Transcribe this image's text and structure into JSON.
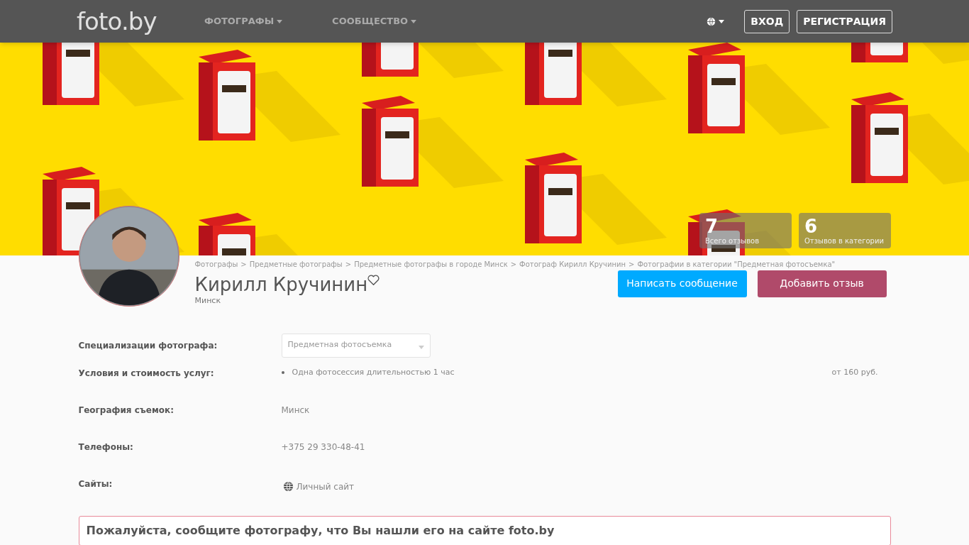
{
  "header": {
    "logo": "foto.by",
    "nav": [
      {
        "label": "ФОТОГРАФЫ"
      },
      {
        "label": "СООБЩЕСТВО"
      }
    ],
    "buttons": [
      "ВХОД",
      "РЕГИСТРАЦИЯ"
    ]
  },
  "stats": [
    {
      "value": "7",
      "label": "Всего отзывов"
    },
    {
      "value": "6",
      "label": "Отзывов в категории"
    }
  ],
  "breadcrumb": {
    "separator": ">",
    "items": [
      "Фотографы",
      "Предметные фотографы",
      "Предметные фотографы в городе Минск",
      "Фотограф Кирилл Кручинин",
      "Фотографии в категории \"Предметная фотосъемка\""
    ]
  },
  "profile": {
    "name": "Кирилл Кручинин",
    "city": "Минск",
    "favorite": false
  },
  "actions": [
    {
      "label": "Написать сообщение",
      "kind": "primary"
    },
    {
      "label": "Добавить отзыв",
      "kind": "secondary"
    }
  ],
  "details": [
    {
      "kind": "select",
      "label": "Специализации фотографа:",
      "value": "Предметная фотосъемка"
    },
    {
      "kind": "price",
      "label": "Условия и стоимость услуг:",
      "value": "Одна фотосессия длительностью 1 час",
      "price": "от 160 руб."
    },
    {
      "kind": "text",
      "label": "География съемок:",
      "value": "Минск"
    },
    {
      "kind": "text",
      "label": "Телефоны:",
      "value": "+375 29 330-48-41"
    },
    {
      "kind": "link",
      "label": "Сайты:",
      "value": "Личный сайт"
    }
  ],
  "notice": "Пожалуйста, сообщите фотографу, что Вы нашли его на сайте foto.by"
}
